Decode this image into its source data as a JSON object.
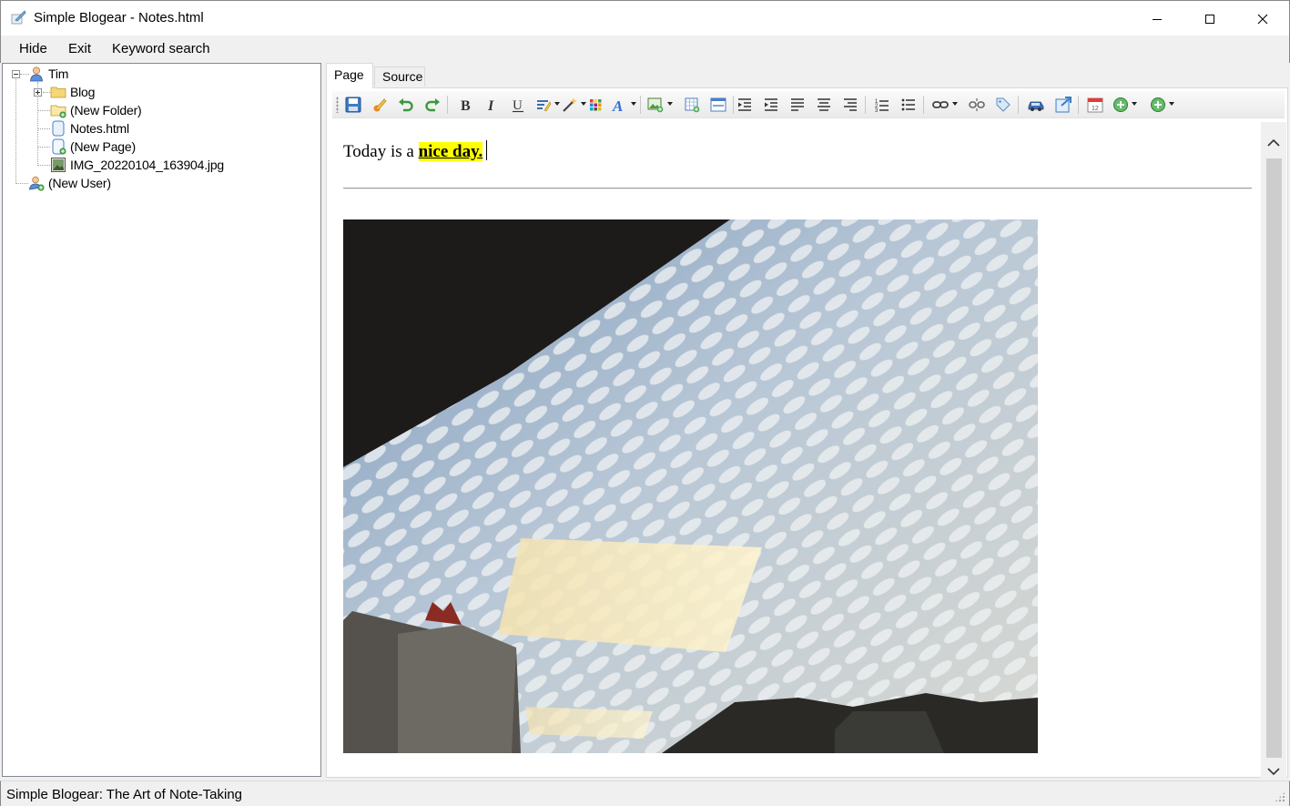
{
  "window": {
    "title": "Simple Blogear - Notes.html"
  },
  "menu": {
    "hide": "Hide",
    "exit": "Exit",
    "keyword_search": "Keyword search"
  },
  "tree": {
    "user": "Tim",
    "blog": "Blog",
    "new_folder": "(New Folder)",
    "notes": "Notes.html",
    "new_page": "(New Page)",
    "image_file": "IMG_20220104_163904.jpg",
    "new_user": "(New User)"
  },
  "tabs": {
    "page": "Page",
    "source": "Source"
  },
  "toolbar": {
    "icons": [
      "save-icon",
      "edit-icon",
      "undo-icon",
      "redo-icon",
      "bold-icon",
      "italic-icon",
      "underline-icon",
      "highlight-icon",
      "magic-wand-icon",
      "color-grid-icon",
      "font-color-icon",
      "insert-image-icon",
      "insert-table-icon",
      "horizontal-rule-icon",
      "outdent-icon",
      "indent-icon",
      "align-left-icon",
      "align-center-icon",
      "align-right-icon",
      "numbered-list-icon",
      "bullet-list-icon",
      "link-icon",
      "unlink-icon",
      "tag-icon",
      "car-icon",
      "publish-icon",
      "calendar-icon",
      "add-circle-icon",
      "add-circle-icon"
    ]
  },
  "document": {
    "text_before": "Today is a ",
    "text_highlight": "nice day.",
    "highlight_color": "#ffff00"
  },
  "status": {
    "text": "Simple Blogear: The Art of Note-Taking"
  }
}
